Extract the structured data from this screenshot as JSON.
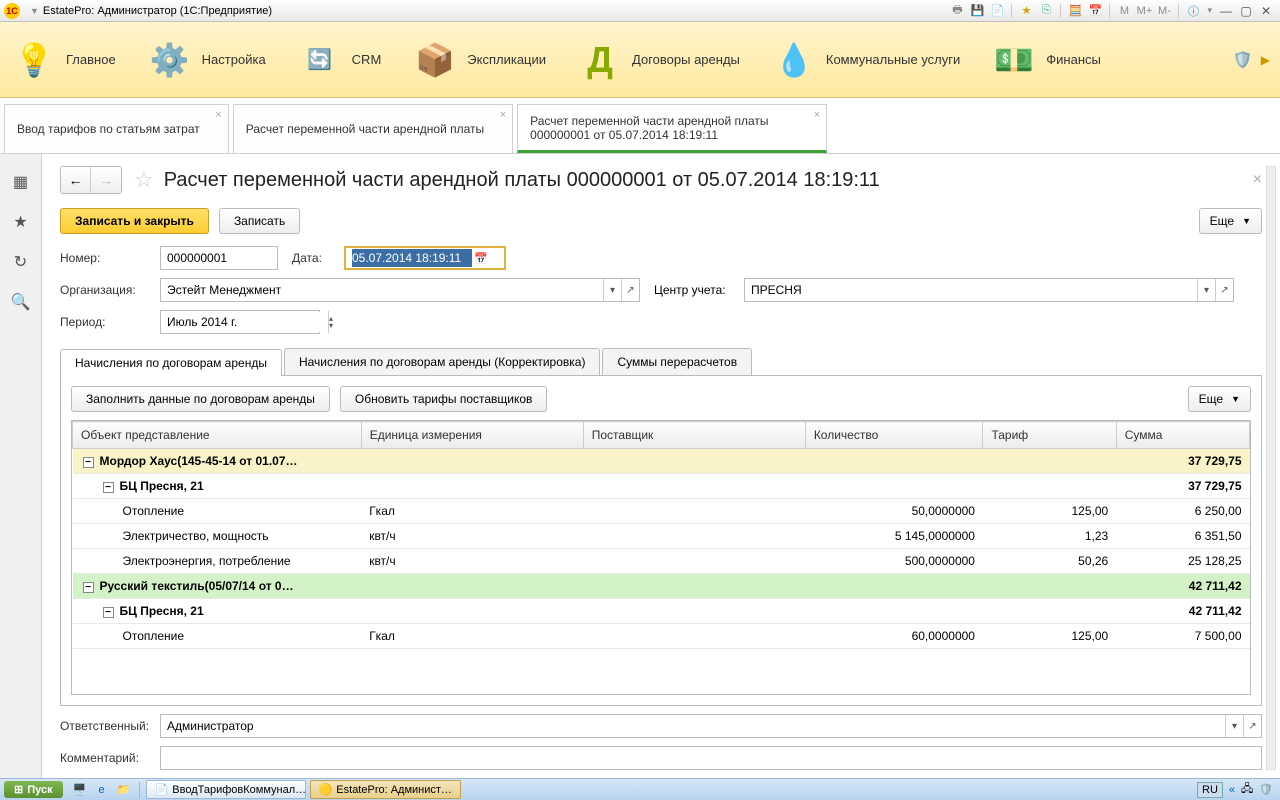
{
  "window": {
    "title": "EstatePro: Администратор (1С:Предприятие)",
    "mem_buttons": [
      "M",
      "M+",
      "M-"
    ]
  },
  "toolbar": [
    {
      "label": "Главное",
      "icon": "💡"
    },
    {
      "label": "Настройка",
      "icon": "⚙️"
    },
    {
      "label": "CRM",
      "icon": "🔄"
    },
    {
      "label": "Экспликации",
      "icon": "📦"
    },
    {
      "label": "Договоры аренды",
      "icon": "Д"
    },
    {
      "label": "Коммунальные услуги",
      "icon": "💧"
    },
    {
      "label": "Финансы",
      "icon": "💵"
    }
  ],
  "shield_icon": "🛡️",
  "tabs": [
    {
      "label": "Ввод тарифов по статьям затрат"
    },
    {
      "label": "Расчет переменной части арендной платы"
    },
    {
      "label": "Расчет переменной части арендной платы 000000001 от 05.07.2014 18:19:11",
      "active": true
    }
  ],
  "page": {
    "title": "Расчет переменной части арендной платы 000000001 от 05.07.2014 18:19:11",
    "save_close": "Записать и закрыть",
    "save": "Записать",
    "more": "Еще",
    "fields": {
      "number_label": "Номер:",
      "number": "000000001",
      "date_label": "Дата:",
      "date": "05.07.2014 18:19:11",
      "org_label": "Организация:",
      "org": "Эстейт Менеджмент",
      "center_label": "Центр учета:",
      "center": "ПРЕСНЯ",
      "period_label": "Период:",
      "period": "Июль 2014 г.",
      "responsible_label": "Ответственный:",
      "responsible": "Администратор",
      "comment_label": "Комментарий:",
      "comment": ""
    },
    "inner_tabs": [
      "Начисления по договорам аренды",
      "Начисления по договорам аренды (Корректировка)",
      "Суммы перерасчетов"
    ],
    "tab_actions": {
      "fill": "Заполнить данные по договорам аренды",
      "update": "Обновить тарифы поставщиков"
    },
    "grid": {
      "columns": [
        "Объект представление",
        "Единица измерения",
        "Поставщик",
        "Количество",
        "Тариф",
        "Сумма"
      ],
      "rows": [
        {
          "type": "group1",
          "c0": "Мордор Хаус(145-45-14 от 01.07…",
          "c5": "37 729,75"
        },
        {
          "type": "sub",
          "c0": "БЦ Пресня, 21",
          "c5": "37 729,75"
        },
        {
          "type": "row",
          "c0": "Отопление",
          "c1": "Гкал",
          "c3": "50,0000000",
          "c4": "125,00",
          "c5": "6 250,00"
        },
        {
          "type": "row",
          "c0": "Электричество, мощность",
          "c1": "квт/ч",
          "c3": "5 145,0000000",
          "c4": "1,23",
          "c5": "6 351,50"
        },
        {
          "type": "row",
          "c0": "Электроэнергия, потребление",
          "c1": "квт/ч",
          "c3": "500,0000000",
          "c4": "50,26",
          "c5": "25 128,25"
        },
        {
          "type": "group2",
          "c0": "Русский текстиль(05/07/14 от 0…",
          "c5": "42 711,42"
        },
        {
          "type": "sub",
          "c0": "БЦ Пресня, 21",
          "c5": "42 711,42"
        },
        {
          "type": "row",
          "c0": "Отопление",
          "c1": "Гкал",
          "c3": "60,0000000",
          "c4": "125,00",
          "c5": "7 500,00"
        }
      ]
    }
  },
  "taskbar": {
    "start": "Пуск",
    "items": [
      {
        "label": "ВводТарифовКоммунал…",
        "icon": "📄"
      },
      {
        "label": "EstatePro: Админист…",
        "icon": "🟡",
        "active": true
      }
    ],
    "lang": "RU"
  }
}
